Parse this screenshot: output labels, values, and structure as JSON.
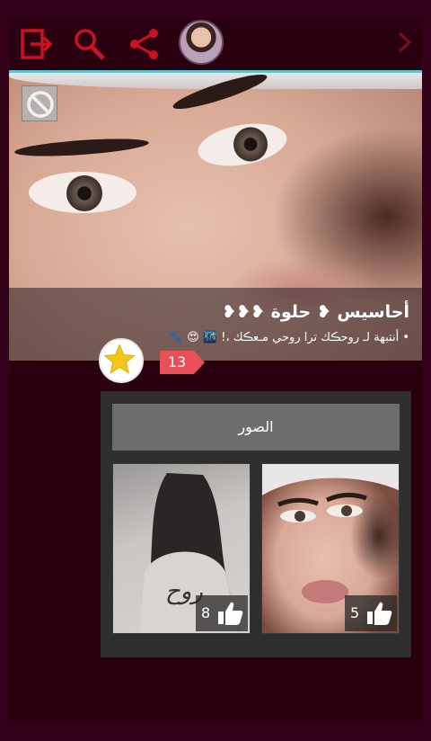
{
  "toolbar": {
    "icons": [
      "exit-icon",
      "search-icon",
      "share-icon"
    ],
    "accent_color": "#cc1122"
  },
  "post": {
    "title": "أحاسيس ❥ حلوة ❥❥❥",
    "subtitle": "• أنتبهة لـ روحڪك ترا روحي مـعڪك ،! 🌃 😍 🐾",
    "likes_count": "13"
  },
  "gallery": {
    "header": "الصور",
    "photos": [
      {
        "likes": "8"
      },
      {
        "likes": "5"
      }
    ]
  }
}
